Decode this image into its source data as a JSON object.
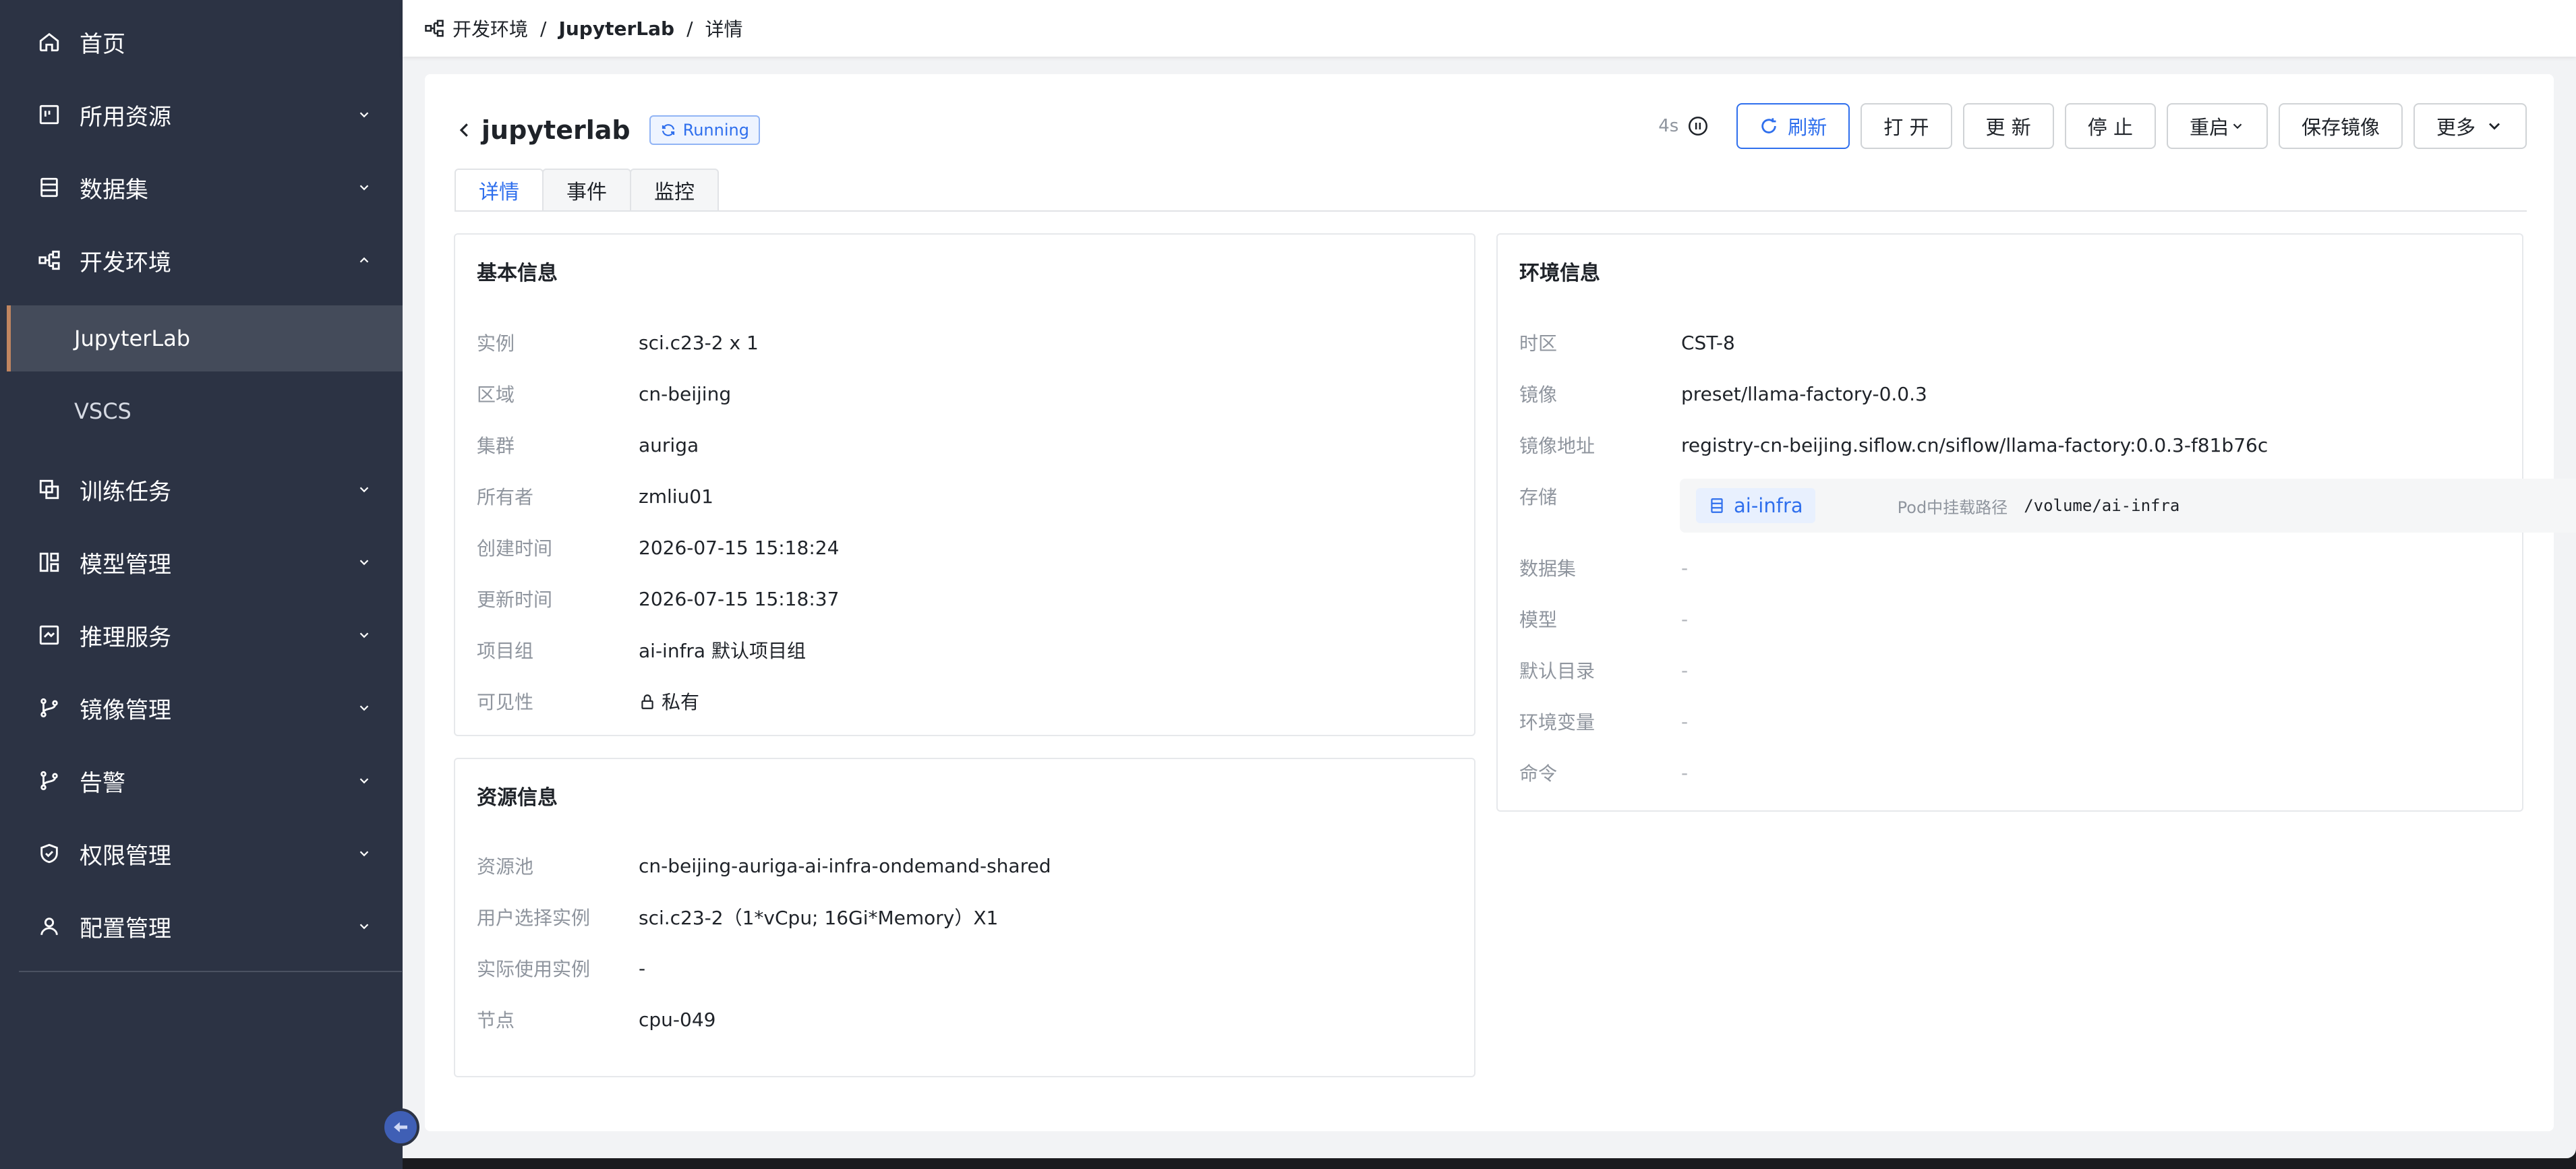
{
  "sidebar": {
    "items": [
      {
        "label": "首页",
        "icon": "home-icon"
      },
      {
        "label": "所用资源",
        "icon": "resource-icon"
      },
      {
        "label": "数据集",
        "icon": "dataset-icon"
      },
      {
        "label": "开发环境",
        "icon": "dev-env-icon"
      },
      {
        "label": "训练任务",
        "icon": "training-icon"
      },
      {
        "label": "模型管理",
        "icon": "model-icon"
      },
      {
        "label": "推理服务",
        "icon": "inference-icon"
      },
      {
        "label": "镜像管理",
        "icon": "image-branch-icon"
      },
      {
        "label": "告警",
        "icon": "alert-branch-icon"
      },
      {
        "label": "权限管理",
        "icon": "shield-icon"
      },
      {
        "label": "配置管理",
        "icon": "user-icon"
      }
    ],
    "sub_items": [
      {
        "label": "JupyterLab"
      },
      {
        "label": "VSCS"
      }
    ]
  },
  "breadcrumb": {
    "items": [
      "开发环境",
      "JupyterLab",
      "详情"
    ],
    "separator": "/"
  },
  "header": {
    "title": "jupyterlab",
    "status": "Running",
    "countdown": "4s"
  },
  "actions": {
    "refresh": "刷新",
    "open": "打 开",
    "update": "更 新",
    "stop": "停 止",
    "restart": "重启",
    "save_image": "保存镜像",
    "more": "更多"
  },
  "tabs": [
    "详情",
    "事件",
    "监控"
  ],
  "basic_info": {
    "title": "基本信息",
    "rows": [
      {
        "k": "实例",
        "v": "sci.c23-2 x 1"
      },
      {
        "k": "区域",
        "v": "cn-beijing"
      },
      {
        "k": "集群",
        "v": "auriga"
      },
      {
        "k": "所有者",
        "v": "zmliu01"
      },
      {
        "k": "创建时间",
        "v": "2026-07-15 15:18:24"
      },
      {
        "k": "更新时间",
        "v": "2026-07-15 15:18:37"
      },
      {
        "k": "项目组",
        "v": "ai-infra 默认项目组"
      },
      {
        "k": "可见性",
        "v": "私有"
      }
    ]
  },
  "resource_info": {
    "title": "资源信息",
    "rows": [
      {
        "k": "资源池",
        "v": "cn-beijing-auriga-ai-infra-ondemand-shared"
      },
      {
        "k": "用户选择实例",
        "v": "sci.c23-2（1*vCpu; 16Gi*Memory）X1"
      },
      {
        "k": "实际使用实例",
        "v": "-"
      },
      {
        "k": "节点",
        "v": "cpu-049"
      }
    ]
  },
  "env_info": {
    "title": "环境信息",
    "timezone": {
      "k": "时区",
      "v": "CST-8"
    },
    "image": {
      "k": "镜像",
      "v": "preset/llama-factory-0.0.3"
    },
    "image_addr": {
      "k": "镜像地址",
      "v": "registry-cn-beijing.siflow.cn/siflow/llama-factory:0.0.3-f81b76c"
    },
    "storage": {
      "k": "存储",
      "name": "ai-infra",
      "mount_label": "Pod中挂载路径",
      "mount_path": "/volume/ai-infra"
    },
    "rows": [
      {
        "k": "数据集",
        "v": "-"
      },
      {
        "k": "模型",
        "v": "-"
      },
      {
        "k": "默认目录",
        "v": "-"
      },
      {
        "k": "环境变量",
        "v": "-"
      },
      {
        "k": "命令",
        "v": "-"
      }
    ]
  },
  "colors": {
    "sidebar_bg": "#2c3344",
    "accent": "#2f6fed",
    "active_marker": "#c08560"
  }
}
